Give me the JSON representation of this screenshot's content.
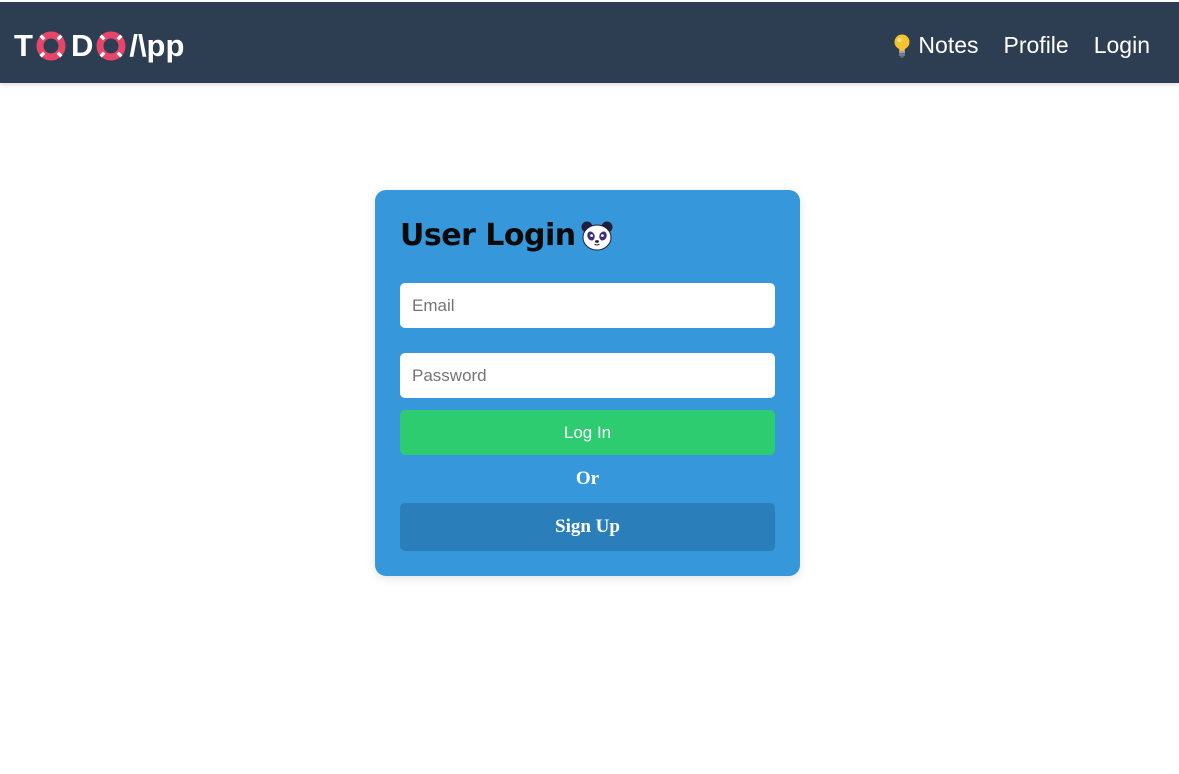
{
  "navbar": {
    "brand": {
      "letters": [
        "T",
        "D",
        "/\\pp"
      ],
      "ring_icon": "lifebuoy-icon",
      "ring_colors": {
        "ring": "#e8456b",
        "stripe": "#ffffff"
      }
    },
    "links": {
      "notes_icon": "lightbulb-icon",
      "notes_label": "Notes",
      "profile_label": "Profile",
      "login_label": "Login"
    },
    "background": "#2e3e52"
  },
  "login_card": {
    "title": "User Login",
    "title_icon": "panda-icon",
    "email": {
      "placeholder": "Email",
      "value": ""
    },
    "password": {
      "placeholder": "Password",
      "value": ""
    },
    "login_button": "Log In",
    "or_text": "Or",
    "signup_button": "Sign Up",
    "colors": {
      "card": "#3697db",
      "login_button": "#2ecc71",
      "signup_button": "#2a7fba"
    }
  }
}
